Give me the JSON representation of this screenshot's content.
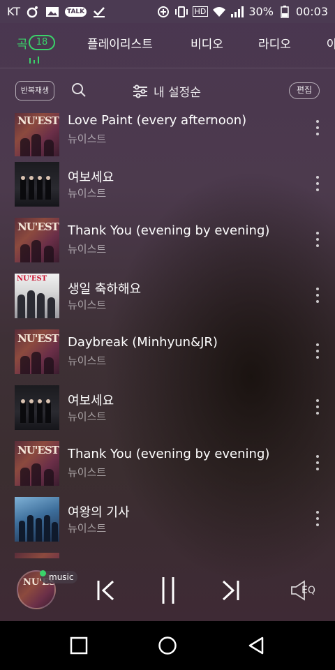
{
  "status_bar": {
    "carrier": "KT",
    "talk_icon_label": "TALK",
    "battery": "30%",
    "time": "00:03",
    "hd_label": "HD"
  },
  "tabs": [
    {
      "label": "곡",
      "badge": "18",
      "active": true
    },
    {
      "label": "플레이리스트",
      "active": false
    },
    {
      "label": "비디오",
      "active": false
    },
    {
      "label": "라디오",
      "active": false
    },
    {
      "label": "아",
      "active": false
    }
  ],
  "toolbar": {
    "repeat_label": "반복재생",
    "sort_label": "내 설정순",
    "edit_label": "편집"
  },
  "songs": [
    {
      "title": "Love Paint (every afternoon)",
      "artist": "뉴이스트",
      "art": "nuest"
    },
    {
      "title": "여보세요",
      "artist": "뉴이스트",
      "art": "dark"
    },
    {
      "title": "Thank You (evening by evening)",
      "artist": "뉴이스트",
      "art": "nuest"
    },
    {
      "title": "생일 축하해요",
      "artist": "뉴이스트",
      "art": "action"
    },
    {
      "title": "Daybreak (Minhyun&JR)",
      "artist": "뉴이스트",
      "art": "nuest"
    },
    {
      "title": "여보세요",
      "artist": "뉴이스트",
      "art": "dark"
    },
    {
      "title": "Thank You (evening by evening)",
      "artist": "뉴이스트",
      "art": "nuest"
    },
    {
      "title": "여왕의 기사",
      "artist": "뉴이스트",
      "art": "blue"
    }
  ],
  "player": {
    "badge_label": "music",
    "eq_label": "EQ",
    "art_logo": "NU'EST"
  },
  "album_logos": {
    "nuest": "NU'EST",
    "action": "NU'EST"
  },
  "colors": {
    "accent": "#3ad36a",
    "background_top": "#4a3650",
    "background_bottom": "#3e2a35"
  }
}
